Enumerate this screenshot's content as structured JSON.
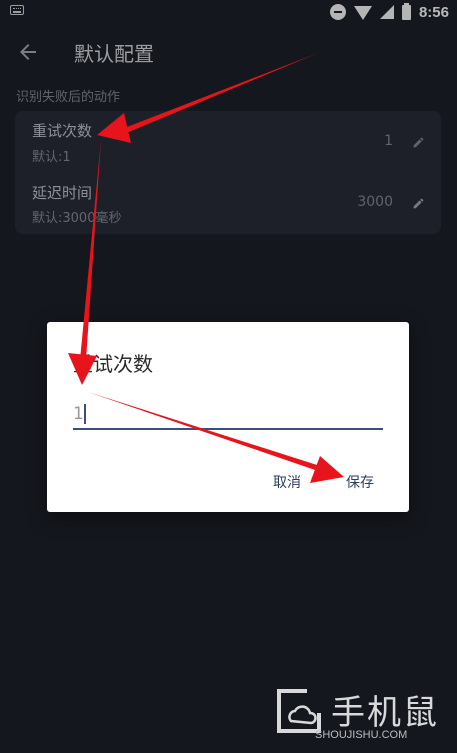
{
  "status_bar": {
    "time": "8:56",
    "icons": [
      "keyboard-icon",
      "do-not-disturb-icon",
      "wifi-icon",
      "signal-icon",
      "battery-icon"
    ]
  },
  "app_bar": {
    "title": "默认配置",
    "back_icon": "arrow-back-icon"
  },
  "section": {
    "label": "识别失败后的动作"
  },
  "settings": [
    {
      "title": "重试次数",
      "subtitle": "默认:1",
      "value": "1",
      "icon": "edit-pencil-icon"
    },
    {
      "title": "延迟时间",
      "subtitle": "默认:3000毫秒",
      "value": "3000",
      "icon": "edit-pencil-icon"
    }
  ],
  "dialog": {
    "title": "重试次数",
    "input_value": "1",
    "cancel_label": "取消",
    "save_label": "保存"
  },
  "watermark": {
    "name": "手机鼠",
    "url": "SHOUJISHU.COM"
  },
  "colors": {
    "background": "#1b1e27",
    "card": "#262a35",
    "dialog": "#ffffff",
    "accent": "#3a4f7d",
    "annotation_arrow": "#e8141c"
  }
}
